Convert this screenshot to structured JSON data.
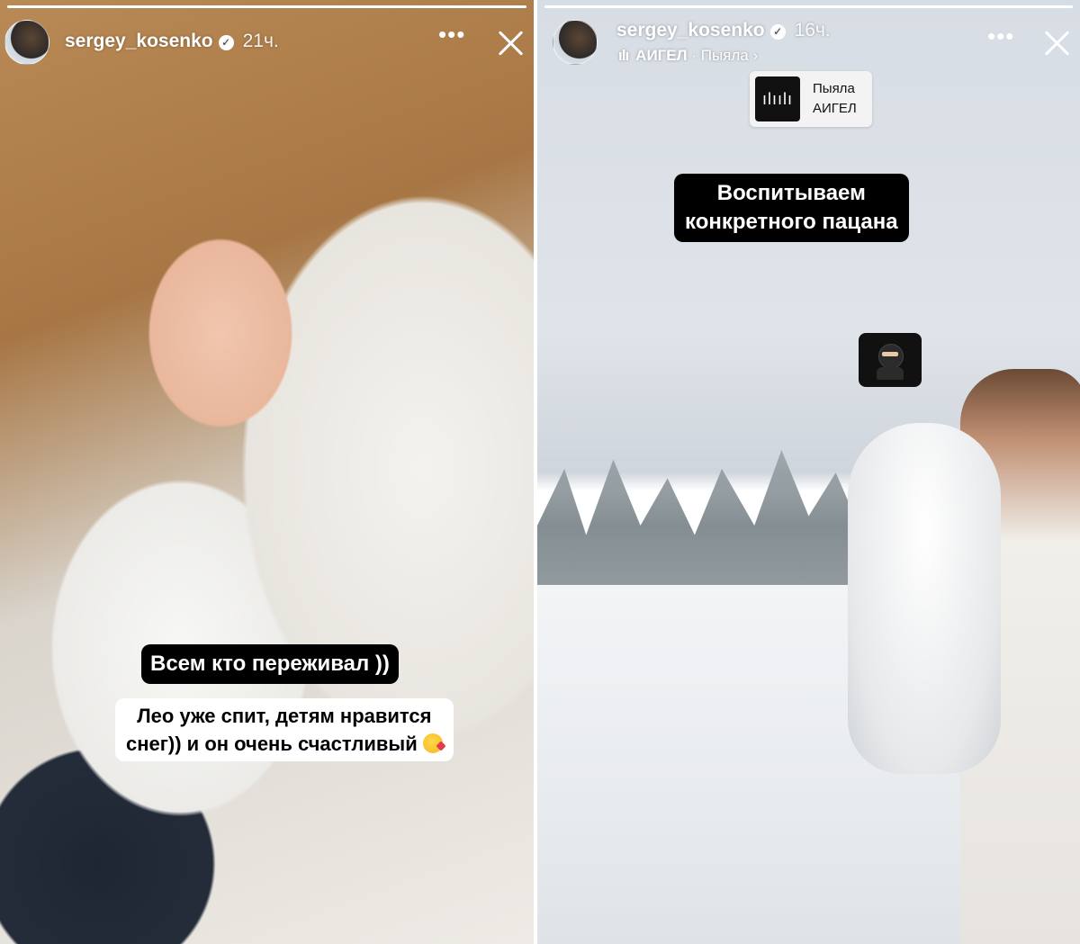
{
  "stories": [
    {
      "username": "sergey_kosenko",
      "time": "21ч.",
      "captions": [
        "Всем кто переживал ))",
        "Лео уже спит, детям нравится",
        "снег)) и он очень счастливый"
      ],
      "icons": {
        "more": "more-options-icon",
        "close": "close-icon",
        "verified": "verified-badge-icon"
      }
    },
    {
      "username": "sergey_kosenko",
      "time": "16ч.",
      "music": {
        "artist": "АИГЕЛ",
        "track": "Пыяла",
        "chevron": "›"
      },
      "music_sticker": {
        "title": "Пыяла",
        "artist": "АИГЕЛ"
      },
      "captions": [
        "Воспитываем",
        "конкретного пацана"
      ],
      "icons": {
        "more": "more-options-icon",
        "close": "close-icon",
        "verified": "verified-badge-icon",
        "sticker": "ninja-icon"
      }
    }
  ],
  "colors": {
    "caption_black": "#000000",
    "caption_white": "#ffffff",
    "progress_track": "rgba(255,255,255,0.45)"
  }
}
